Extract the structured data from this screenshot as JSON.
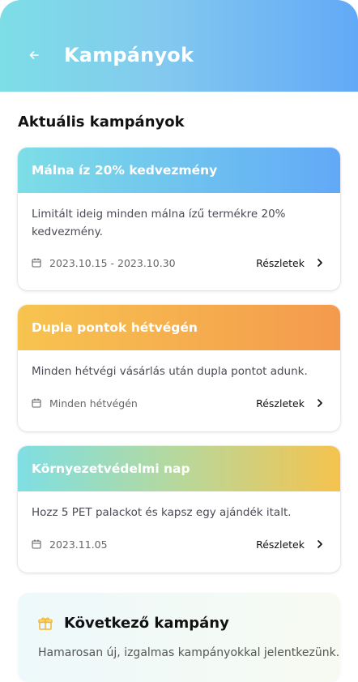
{
  "header": {
    "title": "Kampányok",
    "back_icon": "arrow-left-icon",
    "gradient": [
      "#7ddee6",
      "#62a9f7"
    ]
  },
  "section": {
    "title": "Aktuális kampányok"
  },
  "campaigns": [
    {
      "title": "Málna íz 20% kedvezmény",
      "description": "Limitált ideig minden málna ízű termékre 20% kedvezmény.",
      "date": "2023.10.15 - 2023.10.30",
      "details_label": "Részletek",
      "gradient": [
        "#7ddee6",
        "#62a9f7"
      ]
    },
    {
      "title": "Dupla pontok hétvégén",
      "description": "Minden hétvégi vásárlás után dupla pontot adunk.",
      "date": "Minden hétvégén",
      "details_label": "Részletek",
      "gradient": [
        "#f7c44f",
        "#f49a4e"
      ]
    },
    {
      "title": "Környezetvédelmi nap",
      "description": "Hozz 5 PET palackot és kapsz egy ajándék italt.",
      "date": "2023.11.05",
      "details_label": "Részletek",
      "gradient": [
        "#7edfe3",
        "#f5c34e"
      ]
    }
  ],
  "next_campaign": {
    "title": "Következő kampány",
    "text": "Hamarosan új, izgalmas kampányokkal jelentkezünk.",
    "icon": "gift-icon",
    "icon_color": "#f3b632"
  },
  "icons": {
    "date": "calendar-icon",
    "details": "chevron-right-icon"
  }
}
